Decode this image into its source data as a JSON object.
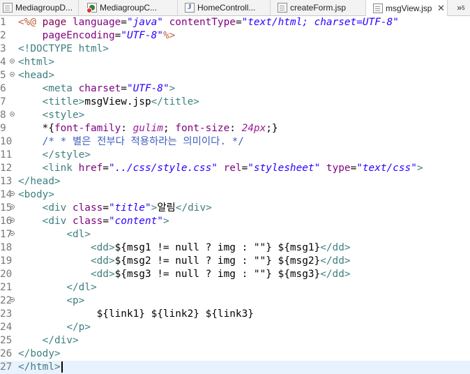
{
  "tabs": [
    {
      "label": "MediagroupD...",
      "icon": "jsp-file-icon",
      "active": false
    },
    {
      "label": "MediagroupC...",
      "icon": "java-class-error-icon",
      "active": false
    },
    {
      "label": "HomeControll...",
      "icon": "java-file-icon",
      "active": false
    },
    {
      "label": "createForm.jsp",
      "icon": "jsp-file-icon",
      "active": false
    },
    {
      "label": "msgView.jsp",
      "icon": "jsp-file-icon",
      "active": true,
      "close": "✕"
    }
  ],
  "overflow_label": "»",
  "overflow_count": "5",
  "current_line": 27,
  "lines": [
    {
      "n": "1",
      "fold": false,
      "segs": [
        [
          "jd",
          "<%@ "
        ],
        [
          "cp",
          "page "
        ],
        [
          "at",
          "language"
        ],
        [
          "tx",
          "="
        ],
        [
          "vl",
          "\"java\""
        ],
        [
          "tx",
          " "
        ],
        [
          "at",
          "contentType"
        ],
        [
          "tx",
          "="
        ],
        [
          "vl",
          "\"text/html; charset=UTF-8\""
        ]
      ]
    },
    {
      "n": "2",
      "fold": false,
      "segs": [
        [
          "tx",
          "    "
        ],
        [
          "at",
          "pageEncoding"
        ],
        [
          "tx",
          "="
        ],
        [
          "vl",
          "\"UTF-8\""
        ],
        [
          "jd",
          "%>"
        ]
      ]
    },
    {
      "n": "3",
      "fold": false,
      "segs": [
        [
          "tg",
          "<!DOCTYPE html>"
        ]
      ]
    },
    {
      "n": "4",
      "fold": true,
      "segs": [
        [
          "tg",
          "<html>"
        ]
      ]
    },
    {
      "n": "5",
      "fold": true,
      "segs": [
        [
          "tg",
          "<head>"
        ]
      ]
    },
    {
      "n": "6",
      "fold": false,
      "segs": [
        [
          "tx",
          "    "
        ],
        [
          "tg",
          "<meta "
        ],
        [
          "at",
          "charset"
        ],
        [
          "tx",
          "="
        ],
        [
          "vl",
          "\"UTF-8\""
        ],
        [
          "tg",
          ">"
        ]
      ]
    },
    {
      "n": "7",
      "fold": false,
      "segs": [
        [
          "tx",
          "    "
        ],
        [
          "tg",
          "<title>"
        ],
        [
          "tx",
          "msgView.jsp"
        ],
        [
          "tg",
          "</title>"
        ]
      ]
    },
    {
      "n": "8",
      "fold": true,
      "segs": [
        [
          "tx",
          "    "
        ],
        [
          "tg",
          "<style>"
        ]
      ]
    },
    {
      "n": "9",
      "fold": false,
      "segs": [
        [
          "tx",
          "    "
        ],
        [
          "cs",
          "*{"
        ],
        [
          "ma",
          "font-family"
        ],
        [
          "cs",
          ": "
        ],
        [
          "mi",
          "gulim"
        ],
        [
          "cs",
          "; "
        ],
        [
          "ma",
          "font-size"
        ],
        [
          "cs",
          ": "
        ],
        [
          "mi",
          "24px"
        ],
        [
          "cs",
          ";}"
        ]
      ]
    },
    {
      "n": "10",
      "fold": false,
      "segs": [
        [
          "tx",
          "    "
        ],
        [
          "cm",
          "/* * 별은 전부다 적용하라는 의미이다. */"
        ]
      ]
    },
    {
      "n": "11",
      "fold": false,
      "segs": [
        [
          "tx",
          "    "
        ],
        [
          "tg",
          "</style>"
        ]
      ]
    },
    {
      "n": "12",
      "fold": false,
      "segs": [
        [
          "tx",
          "    "
        ],
        [
          "tg",
          "<link "
        ],
        [
          "at",
          "href"
        ],
        [
          "tx",
          "="
        ],
        [
          "vl",
          "\"../css/style.css\""
        ],
        [
          "tx",
          " "
        ],
        [
          "at",
          "rel"
        ],
        [
          "tx",
          "="
        ],
        [
          "vl",
          "\"stylesheet\""
        ],
        [
          "tx",
          " "
        ],
        [
          "at",
          "type"
        ],
        [
          "tx",
          "="
        ],
        [
          "vl",
          "\"text/css\""
        ],
        [
          "tg",
          ">"
        ]
      ]
    },
    {
      "n": "13",
      "fold": false,
      "segs": [
        [
          "tg",
          "</head>"
        ]
      ]
    },
    {
      "n": "14",
      "fold": true,
      "segs": [
        [
          "tg",
          "<body>"
        ]
      ]
    },
    {
      "n": "15",
      "fold": true,
      "segs": [
        [
          "tx",
          "    "
        ],
        [
          "tg",
          "<div "
        ],
        [
          "at",
          "class"
        ],
        [
          "tx",
          "="
        ],
        [
          "vl",
          "\"title\""
        ],
        [
          "tg",
          ">"
        ],
        [
          "tx",
          "알림"
        ],
        [
          "tg",
          "</div>"
        ]
      ]
    },
    {
      "n": "16",
      "fold": true,
      "segs": [
        [
          "tx",
          "    "
        ],
        [
          "tg",
          "<div "
        ],
        [
          "at",
          "class"
        ],
        [
          "tx",
          "="
        ],
        [
          "vl",
          "\"content\""
        ],
        [
          "tg",
          ">"
        ]
      ]
    },
    {
      "n": "17",
      "fold": true,
      "segs": [
        [
          "tx",
          "        "
        ],
        [
          "tg",
          "<dl>"
        ]
      ]
    },
    {
      "n": "18",
      "fold": false,
      "segs": [
        [
          "tx",
          "            "
        ],
        [
          "tg",
          "<dd>"
        ],
        [
          "tx",
          "${msg1 != null ? img : \"\"} ${msg1}"
        ],
        [
          "tg",
          "</dd>"
        ]
      ]
    },
    {
      "n": "19",
      "fold": false,
      "segs": [
        [
          "tx",
          "            "
        ],
        [
          "tg",
          "<dd>"
        ],
        [
          "tx",
          "${msg2 != null ? img : \"\"} ${msg2}"
        ],
        [
          "tg",
          "</dd>"
        ]
      ]
    },
    {
      "n": "20",
      "fold": false,
      "segs": [
        [
          "tx",
          "            "
        ],
        [
          "tg",
          "<dd>"
        ],
        [
          "tx",
          "${msg3 != null ? img : \"\"} ${msg3}"
        ],
        [
          "tg",
          "</dd>"
        ]
      ]
    },
    {
      "n": "21",
      "fold": false,
      "segs": [
        [
          "tx",
          "        "
        ],
        [
          "tg",
          "</dl>"
        ]
      ]
    },
    {
      "n": "22",
      "fold": true,
      "segs": [
        [
          "tx",
          "        "
        ],
        [
          "tg",
          "<p>"
        ]
      ]
    },
    {
      "n": "23",
      "fold": false,
      "segs": [
        [
          "tx",
          "             ${link1} ${link2} ${link3}"
        ]
      ]
    },
    {
      "n": "24",
      "fold": false,
      "segs": [
        [
          "tx",
          "        "
        ],
        [
          "tg",
          "</p>"
        ]
      ]
    },
    {
      "n": "25",
      "fold": false,
      "segs": [
        [
          "tx",
          "    "
        ],
        [
          "tg",
          "</div>"
        ]
      ]
    },
    {
      "n": "26",
      "fold": false,
      "segs": [
        [
          "tg",
          "</body>"
        ]
      ]
    },
    {
      "n": "27",
      "fold": false,
      "segs": [
        [
          "tg",
          "</html>"
        ]
      ]
    }
  ]
}
